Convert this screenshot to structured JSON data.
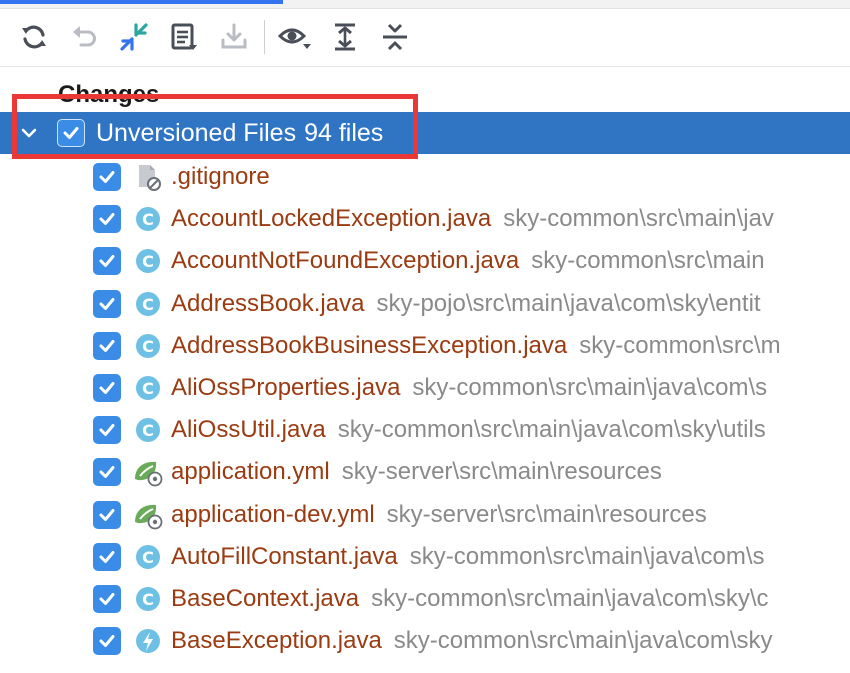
{
  "toolbar": {
    "buttons": [
      {
        "name": "refresh-icon"
      },
      {
        "name": "rollback-icon"
      },
      {
        "name": "diff-icon"
      },
      {
        "name": "commit-message-icon"
      },
      {
        "name": "shelve-icon"
      },
      {
        "name": "view-options-icon"
      },
      {
        "name": "expand-all-icon"
      },
      {
        "name": "collapse-all-icon"
      }
    ]
  },
  "tree": {
    "group_title": "Changes",
    "root": {
      "label": "Unversioned Files",
      "count": "94 files"
    },
    "files": [
      {
        "name": ".gitignore",
        "path": "",
        "icon": "ignore-file-icon"
      },
      {
        "name": "AccountLockedException.java",
        "path": "sky-common\\src\\main\\jav",
        "icon": "class-icon"
      },
      {
        "name": "AccountNotFoundException.java",
        "path": "sky-common\\src\\main",
        "icon": "class-icon"
      },
      {
        "name": "AddressBook.java",
        "path": "sky-pojo\\src\\main\\java\\com\\sky\\entit",
        "icon": "class-icon"
      },
      {
        "name": "AddressBookBusinessException.java",
        "path": "sky-common\\src\\m",
        "icon": "class-icon"
      },
      {
        "name": "AliOssProperties.java",
        "path": "sky-common\\src\\main\\java\\com\\s",
        "icon": "class-icon"
      },
      {
        "name": "AliOssUtil.java",
        "path": "sky-common\\src\\main\\java\\com\\sky\\utils",
        "icon": "class-icon"
      },
      {
        "name": "application.yml",
        "path": "sky-server\\src\\main\\resources",
        "icon": "spring-config-icon"
      },
      {
        "name": "application-dev.yml",
        "path": "sky-server\\src\\main\\resources",
        "icon": "spring-config-icon"
      },
      {
        "name": "AutoFillConstant.java",
        "path": "sky-common\\src\\main\\java\\com\\s",
        "icon": "class-icon"
      },
      {
        "name": "BaseContext.java",
        "path": "sky-common\\src\\main\\java\\com\\sky\\c",
        "icon": "class-icon"
      },
      {
        "name": "BaseException.java",
        "path": "sky-common\\src\\main\\java\\com\\sky",
        "icon": "exception-class-icon"
      }
    ]
  },
  "colors": {
    "selection": "#2f75c4",
    "checkbox": "#3a8ce6",
    "unversioned_name": "#9a3b12",
    "path": "#8a8a8a",
    "highlight_box": "#ea3838",
    "class_icon": "#6ec1e4",
    "spring_icon": "#6aab5a"
  }
}
